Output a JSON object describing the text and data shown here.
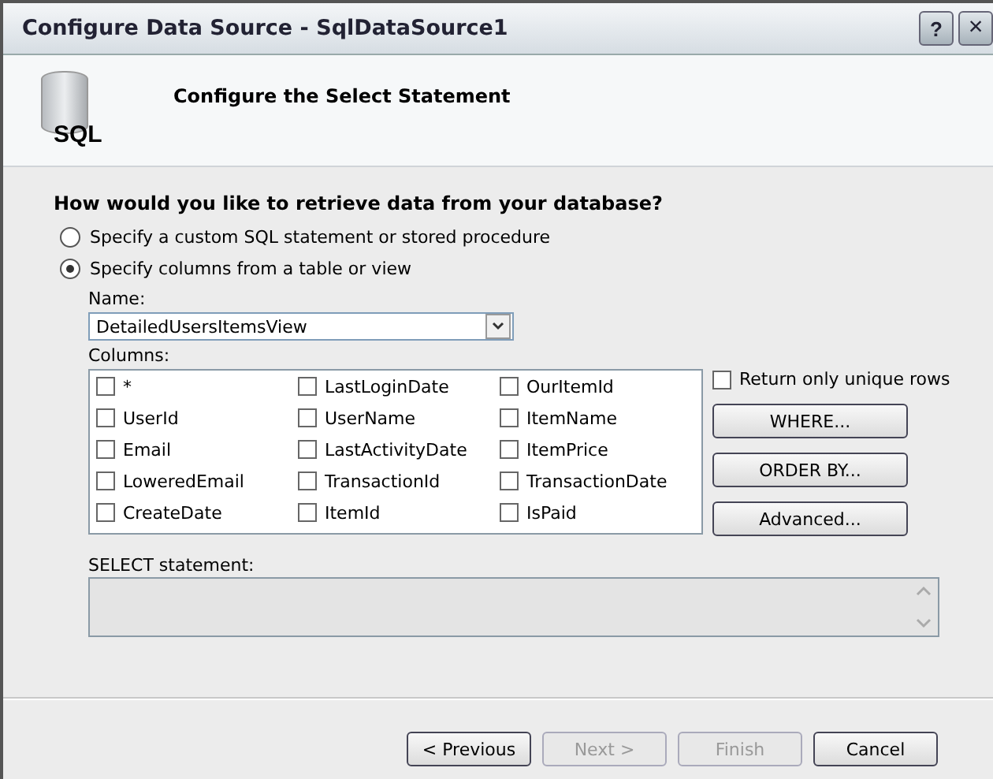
{
  "window": {
    "title": "Configure Data Source - SqlDataSource1",
    "title_buttons": [
      {
        "kind": "help",
        "label": "?"
      },
      {
        "kind": "close",
        "label": "×"
      }
    ]
  },
  "header": {
    "icon_label": "SQL",
    "title": "Configure the Select Statement"
  },
  "question": "How would you like to retrieve data from your database?",
  "options": [
    {
      "label": "Specify a custom SQL statement or stored procedure",
      "selected": false
    },
    {
      "label": "Specify columns from a table or view",
      "selected": true
    }
  ],
  "name_field": {
    "label": "Name:",
    "value": "DetailedUsersItemsView"
  },
  "columns_label": "Columns:",
  "columns": [
    {
      "label": "*",
      "checked": false
    },
    {
      "label": "UserId",
      "checked": false
    },
    {
      "label": "Email",
      "checked": false
    },
    {
      "label": "LoweredEmail",
      "checked": false
    },
    {
      "label": "CreateDate",
      "checked": false
    },
    {
      "label": "LastLoginDate",
      "checked": false
    },
    {
      "label": "UserName",
      "checked": false
    },
    {
      "label": "LastActivityDate",
      "checked": false
    },
    {
      "label": "TransactionId",
      "checked": false
    },
    {
      "label": "ItemId",
      "checked": false
    },
    {
      "label": "OurItemId",
      "checked": false
    },
    {
      "label": "ItemName",
      "checked": false
    },
    {
      "label": "ItemPrice",
      "checked": false
    },
    {
      "label": "TransactionDate",
      "checked": false
    },
    {
      "label": "IsPaid",
      "checked": false
    }
  ],
  "unique_rows": {
    "label": "Return only unique rows",
    "checked": false
  },
  "side_buttons": [
    "WHERE...",
    "ORDER BY...",
    "Advanced..."
  ],
  "select_statement": {
    "label": "SELECT statement:"
  },
  "footer_buttons": [
    {
      "label": "< Previous",
      "disabled": false
    },
    {
      "label": "Next >",
      "disabled": true
    },
    {
      "label": "Finish",
      "disabled": true
    },
    {
      "label": "Cancel",
      "disabled": false
    }
  ]
}
